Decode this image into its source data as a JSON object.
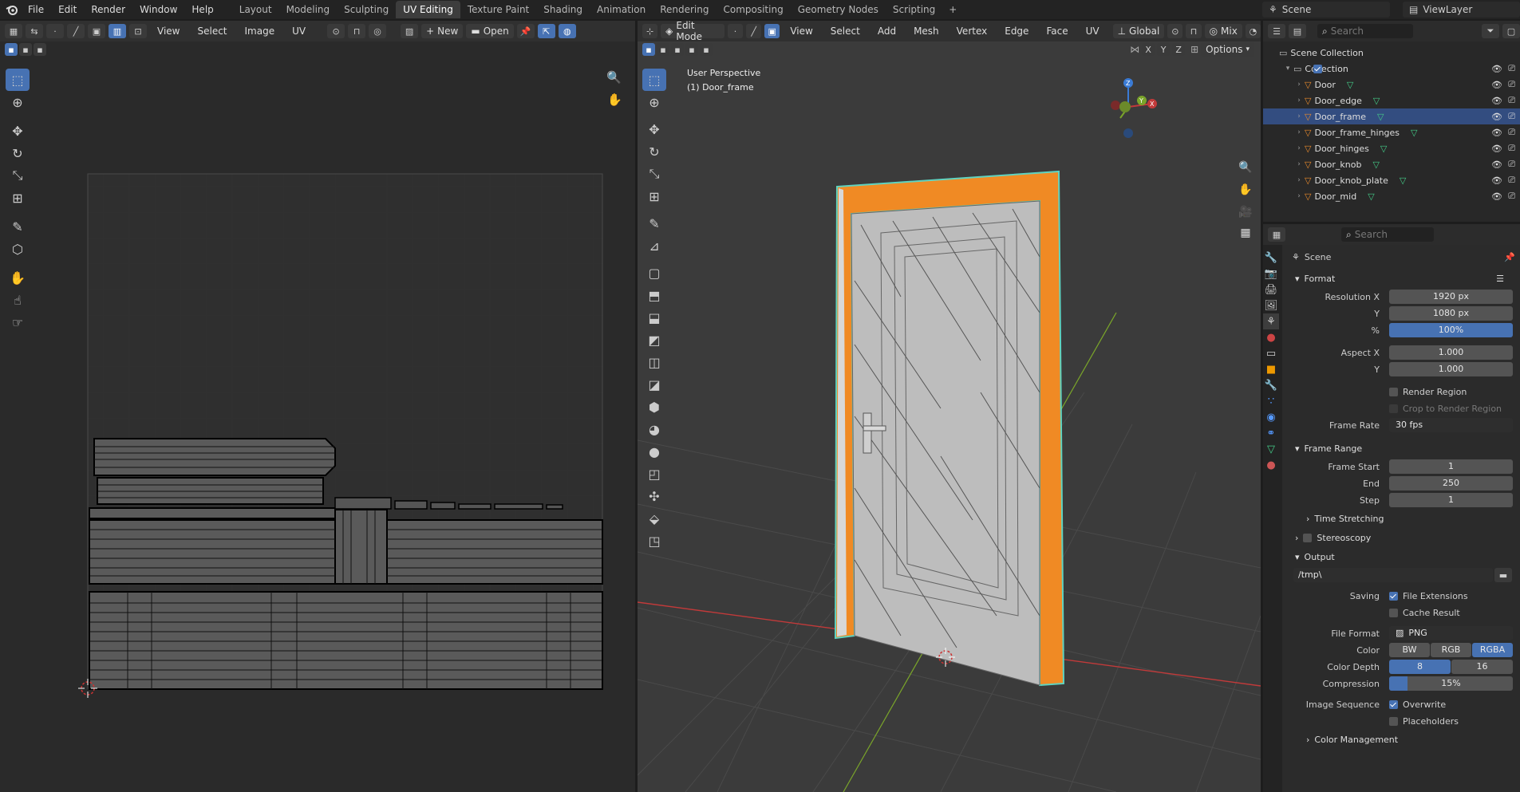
{
  "topbar": {
    "menus": [
      "File",
      "Edit",
      "Render",
      "Window",
      "Help"
    ],
    "workspaces": [
      "Layout",
      "Modeling",
      "Sculpting",
      "UV Editing",
      "Texture Paint",
      "Shading",
      "Animation",
      "Rendering",
      "Compositing",
      "Geometry Nodes",
      "Scripting"
    ],
    "active_workspace": "UV Editing",
    "scene_name": "Scene",
    "view_layer": "ViewLayer"
  },
  "uv_editor": {
    "menus": [
      "View",
      "Select",
      "Image",
      "UV"
    ],
    "new_label": "New",
    "open_label": "Open"
  },
  "viewport": {
    "mode": "Edit Mode",
    "menus": [
      "View",
      "Select",
      "Add",
      "Mesh",
      "Vertex",
      "Edge",
      "Face",
      "UV"
    ],
    "orientation": "Global",
    "shading_mix": "Mix",
    "options_label": "Options",
    "axis_x": "X",
    "axis_y": "Y",
    "axis_z": "Z",
    "overlay_line1": "User Perspective",
    "overlay_line2": "(1) Door_frame",
    "colors": {
      "selected_edge": "#f08a24",
      "active_outline": "#5fd3c0",
      "x_axis": "#c23a3a",
      "y_axis": "#7aa52a"
    }
  },
  "outliner": {
    "search_placeholder": "Search",
    "scene_collection": "Scene Collection",
    "collection": "Collection",
    "objects": [
      "Door",
      "Door_edge",
      "Door_frame",
      "Door_frame_hinges",
      "Door_hinges",
      "Door_knob",
      "Door_knob_plate",
      "Door_mid"
    ],
    "selected": "Door_frame"
  },
  "properties": {
    "search_placeholder": "Search",
    "context": "Scene",
    "format": {
      "title": "Format",
      "res_x_label": "Resolution X",
      "res_x": "1920 px",
      "res_y_label": "Y",
      "res_y": "1080 px",
      "pct_label": "%",
      "pct": "100%",
      "aspect_x_label": "Aspect X",
      "aspect_x": "1.000",
      "aspect_y_label": "Y",
      "aspect_y": "1.000",
      "render_region": "Render Region",
      "crop": "Crop to Render Region",
      "frame_rate_label": "Frame Rate",
      "frame_rate": "30 fps"
    },
    "frame_range": {
      "title": "Frame Range",
      "start_label": "Frame Start",
      "start": "1",
      "end_label": "End",
      "end": "250",
      "step_label": "Step",
      "step": "1",
      "time_stretching": "Time Stretching"
    },
    "stereoscopy": "Stereoscopy",
    "output": {
      "title": "Output",
      "path": "/tmp\\",
      "saving_label": "Saving",
      "file_extensions": "File Extensions",
      "cache_result": "Cache Result",
      "file_format_label": "File Format",
      "file_format": "PNG",
      "color_label": "Color",
      "color_bw": "BW",
      "color_rgb": "RGB",
      "color_rgba": "RGBA",
      "depth_label": "Color Depth",
      "depth_8": "8",
      "depth_16": "16",
      "compression_label": "Compression",
      "compression": "15%",
      "image_seq_label": "Image Sequence",
      "overwrite": "Overwrite",
      "placeholders": "Placeholders",
      "color_management": "Color Management"
    }
  }
}
